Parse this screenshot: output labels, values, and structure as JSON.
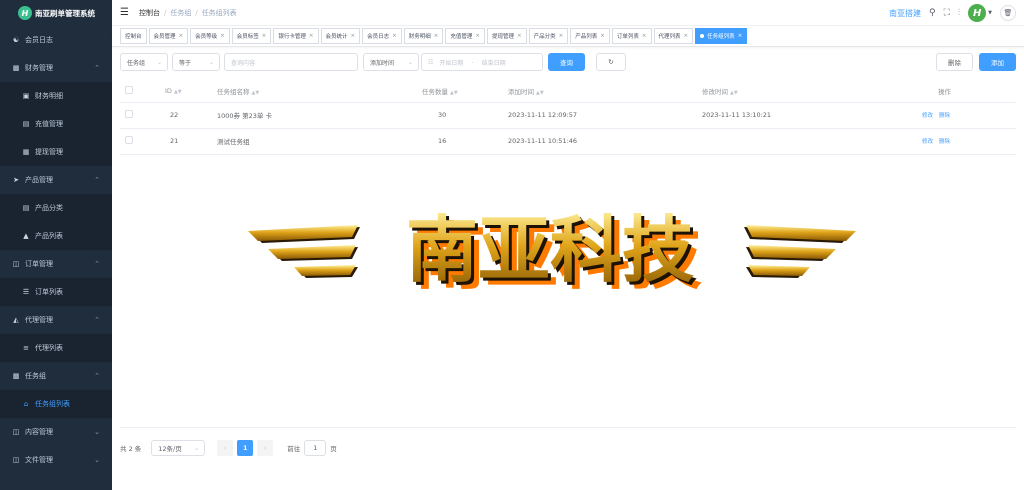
{
  "app": {
    "title": "南亚刷单管理系统",
    "logo_letter": "H"
  },
  "sidebar": {
    "items": [
      {
        "label": "会员日志",
        "icon": "user-icon",
        "type": "item"
      },
      {
        "label": "财务管理",
        "icon": "bar-chart-icon",
        "type": "group"
      },
      {
        "label": "财务明细",
        "icon": "money-icon",
        "type": "sub"
      },
      {
        "label": "充值管理",
        "icon": "recharge-icon",
        "type": "sub"
      },
      {
        "label": "提现管理",
        "icon": "withdraw-icon",
        "type": "sub"
      },
      {
        "label": "产品管理",
        "icon": "send-icon",
        "type": "group"
      },
      {
        "label": "产品分类",
        "icon": "document-icon",
        "type": "sub"
      },
      {
        "label": "产品列表",
        "icon": "shopping-bag-icon",
        "type": "sub"
      },
      {
        "label": "订单管理",
        "icon": "order-icon",
        "type": "group"
      },
      {
        "label": "订单列表",
        "icon": "list-icon",
        "type": "sub"
      },
      {
        "label": "代理管理",
        "icon": "agent-icon",
        "type": "group"
      },
      {
        "label": "代理列表",
        "icon": "menu-icon",
        "type": "sub"
      },
      {
        "label": "任务组",
        "icon": "task-icon",
        "type": "group"
      },
      {
        "label": "任务组列表",
        "icon": "home-icon",
        "type": "sub-active"
      },
      {
        "label": "内容管理",
        "icon": "content-icon",
        "type": "group-collapsed"
      },
      {
        "label": "文件管理",
        "icon": "folder-icon",
        "type": "group-collapsed"
      }
    ]
  },
  "header": {
    "breadcrumb": [
      "控制台",
      "任务组",
      "任务组列表"
    ],
    "site_link": "南亚搭建",
    "avatar_letter": "H"
  },
  "tabs": [
    "控制台",
    "会员管理",
    "会员等级",
    "会员标签",
    "银行卡管理",
    "会员统计",
    "会员日志",
    "财务明细",
    "充值管理",
    "提现管理",
    "产品分类",
    "产品列表",
    "订单列表",
    "代理列表",
    "任务组列表"
  ],
  "filters": {
    "field_select": "任务组",
    "op_select": "等于",
    "keyword_placeholder": "查询内容",
    "time_select": "添加时间",
    "start_placeholder": "开始日期",
    "range_sep": "-",
    "end_placeholder": "结束日期",
    "search_label": "查询",
    "delete_label": "删除",
    "add_label": "添加"
  },
  "table": {
    "headers": [
      "ID",
      "任务组名称",
      "任务数量",
      "添加时间",
      "修改时间",
      "操作"
    ],
    "rows": [
      {
        "id": "22",
        "name": "1000券 第23单 卡",
        "count": "30",
        "created": "2023-11-11 12:09:57",
        "updated": "2023-11-11 13:10:21",
        "edit": "修改",
        "delete": "删除"
      },
      {
        "id": "21",
        "name": "测试任务组",
        "count": "16",
        "created": "2023-11-11 10:51:46",
        "updated": "",
        "edit": "修改",
        "delete": "删除"
      }
    ]
  },
  "banner": {
    "text": "南亚科技"
  },
  "pagination": {
    "total": "共 2 条",
    "page_size": "12条/页",
    "current_page": "1",
    "goto_label": "前往",
    "goto_value": "1",
    "page_suffix": "页"
  },
  "colors": {
    "primary": "#409eff",
    "sidebar_bg": "#1f2d3d",
    "logo_green": "#3cbf8f"
  }
}
